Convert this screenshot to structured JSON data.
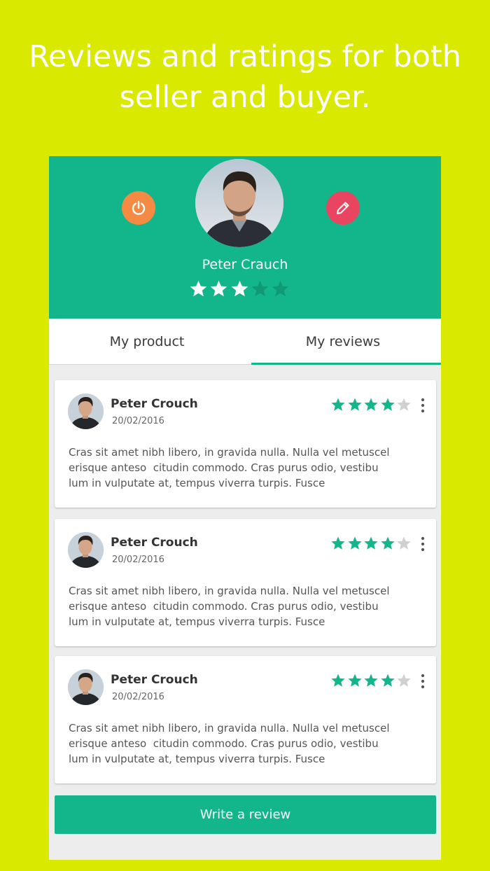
{
  "headline": {
    "line1": "Reviews and ratings for both",
    "line2": "seller and buyer."
  },
  "colors": {
    "background": "#d9ea00",
    "accent": "#13b68a",
    "power_button": "#f58a43",
    "edit_button": "#ea4560",
    "star_filled": "#13b68a",
    "star_empty": "#d0d0d0"
  },
  "profile": {
    "name": "Peter Crauch",
    "rating": 3,
    "rating_max": 5,
    "power_icon": "power-icon",
    "edit_icon": "pencil-icon"
  },
  "tabs": [
    {
      "label": "My product",
      "active": false
    },
    {
      "label": "My reviews",
      "active": true
    }
  ],
  "reviews": [
    {
      "name": "Peter Crouch",
      "date": "20/02/2016",
      "rating": 4,
      "text": "Cras sit amet nibh libero, in gravida nulla. Nulla vel metuscel\nerisque anteso  citudin commodo. Cras purus odio, vestibu\nlum in vulputate at, tempus viverra turpis. Fusce"
    },
    {
      "name": "Peter Crouch",
      "date": "20/02/2016",
      "rating": 4,
      "text": "Cras sit amet nibh libero, in gravida nulla. Nulla vel metuscel\nerisque anteso  citudin commodo. Cras purus odio, vestibu\nlum in vulputate at, tempus viverra turpis. Fusce"
    },
    {
      "name": "Peter Crouch",
      "date": "20/02/2016",
      "rating": 4,
      "text": "Cras sit amet nibh libero, in gravida nulla. Nulla vel metuscel\nerisque anteso  citudin commodo. Cras purus odio, vestibu\nlum in vulputate at, tempus viverra turpis. Fusce"
    }
  ],
  "write_review_label": "Write a review"
}
